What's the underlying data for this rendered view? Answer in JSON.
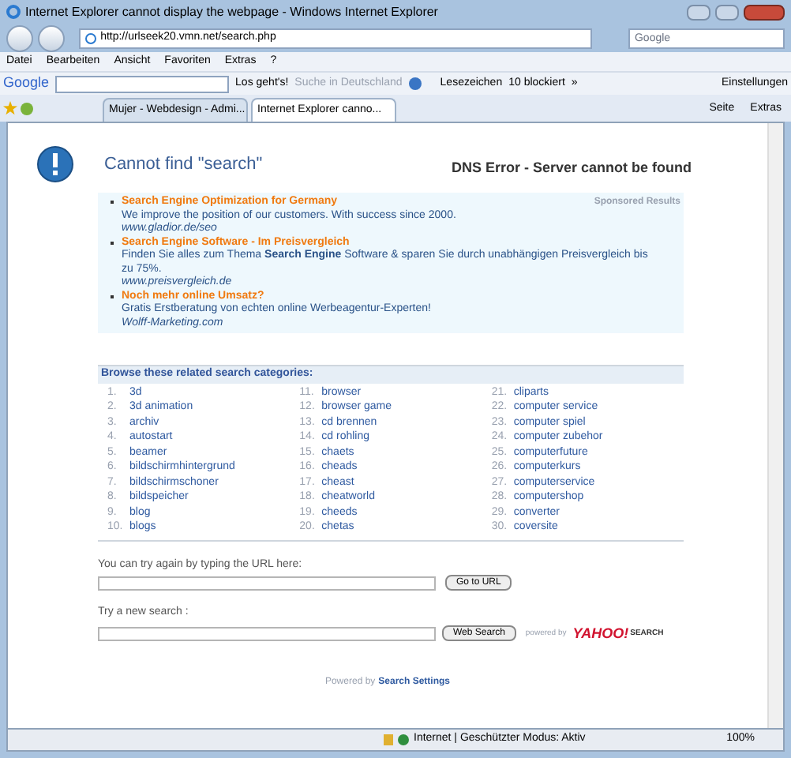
{
  "window": {
    "title": "Internet Explorer cannot display the webpage - Windows Internet Explorer"
  },
  "address_bar": {
    "url": "http://urlseek20.vmn.net/search.php",
    "search_placeholder": "Google"
  },
  "menu": [
    "Datei",
    "Bearbeiten",
    "Ansicht",
    "Favoriten",
    "Extras",
    "?"
  ],
  "google_toolbar": {
    "logo": "Google",
    "go_button": "Los geht's!",
    "search_germany": "Suche in Deutschland",
    "bookmarks": "Lesezeichen",
    "blocked": "10 blockiert",
    "more": "»",
    "settings": "Einstellungen"
  },
  "tabs": [
    {
      "label": "Mujer - Webdesign - Admi...",
      "selected": false
    },
    {
      "label": "Internet Explorer canno...",
      "selected": true
    }
  ],
  "commands": [
    "Seite",
    "Extras"
  ],
  "page": {
    "title": "Cannot find \"search\"",
    "error": "DNS Error - Server cannot be found",
    "sponsored": {
      "label": "Sponsored Results",
      "ads": [
        {
          "title": "Search Engine Optimization for Germany",
          "text": "We improve the position of our customers. With success since 2000.",
          "url": "www.gladior.de/seo"
        },
        {
          "title": "Search Engine Software - Im Preisvergleich",
          "text": "Finden Sie alles zum Thema **Search Engine** Software & sparen Sie durch unabhängigen Preisvergleich bis zu 75%.",
          "url": "www.preisvergleich.de"
        },
        {
          "title": "Noch mehr online Umsatz?",
          "text": "Gratis Erstberatung von echten online Werbeagentur-Experten!",
          "url": "Wolff-Marketing.com"
        }
      ]
    },
    "categories": {
      "heading": "Browse these related search categories:",
      "items": [
        {
          "number": "1.",
          "label": "3d"
        },
        {
          "number": "2.",
          "label": "3d animation"
        },
        {
          "number": "3.",
          "label": "archiv"
        },
        {
          "number": "4.",
          "label": "autostart"
        },
        {
          "number": "5.",
          "label": "beamer"
        },
        {
          "number": "6.",
          "label": "bildschirmhintergrund"
        },
        {
          "number": "7.",
          "label": "bildschirmschoner"
        },
        {
          "number": "8.",
          "label": "bildspeicher"
        },
        {
          "number": "9.",
          "label": "blog"
        },
        {
          "number": "10.",
          "label": "blogs"
        },
        {
          "number": "11.",
          "label": "browser"
        },
        {
          "number": "12.",
          "label": "browser game"
        },
        {
          "number": "13.",
          "label": "cd brennen"
        },
        {
          "number": "14.",
          "label": "cd rohling"
        },
        {
          "number": "15.",
          "label": "chaets"
        },
        {
          "number": "16.",
          "label": "cheads"
        },
        {
          "number": "17.",
          "label": "cheast"
        },
        {
          "number": "18.",
          "label": "cheatworld"
        },
        {
          "number": "19.",
          "label": "cheeds"
        },
        {
          "number": "20.",
          "label": "chetas"
        },
        {
          "number": "21.",
          "label": "cliparts"
        },
        {
          "number": "22.",
          "label": "computer service"
        },
        {
          "number": "23.",
          "label": "computer spiel"
        },
        {
          "number": "24.",
          "label": "computer zubehor"
        },
        {
          "number": "25.",
          "label": "computerfuture"
        },
        {
          "number": "26.",
          "label": "computerkurs"
        },
        {
          "number": "27.",
          "label": "computerservice"
        },
        {
          "number": "28.",
          "label": "computershop"
        },
        {
          "number": "29.",
          "label": "converter"
        },
        {
          "number": "30.",
          "label": "coversite"
        }
      ]
    },
    "retry": {
      "label": "You can try again by typing the URL here:",
      "button": "Go to URL"
    },
    "new_search": {
      "label": "Try a new search :",
      "button": "Web Search",
      "powered": "powered by",
      "logo": "YAHOO!",
      "logo_suffix": "SEARCH"
    },
    "footer": {
      "prefix": "Powered by",
      "link": "Search Settings"
    }
  },
  "status_bar": {
    "zone": "Internet | Geschützter Modus: Aktiv",
    "zoom": "100%"
  }
}
